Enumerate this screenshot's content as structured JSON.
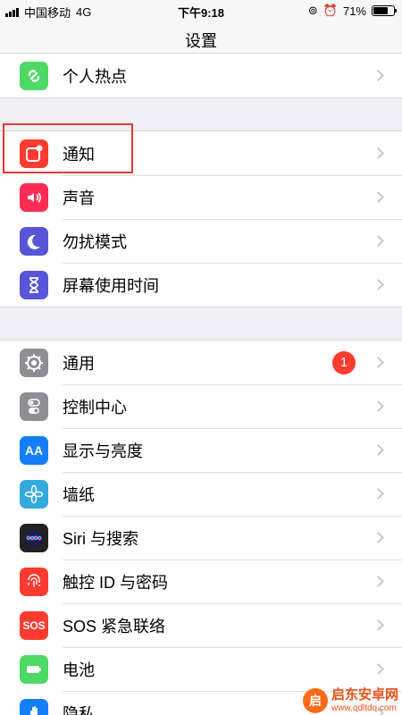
{
  "statusbar": {
    "carrier": "中国移动",
    "network": "4G",
    "time": "下午9:18",
    "battery_percent": "71%",
    "battery_level": 0.71
  },
  "navbar": {
    "title": "设置"
  },
  "sections": [
    {
      "items": [
        {
          "label": "个人热点",
          "icon": "hotspot-icon",
          "color": "#4cd964"
        }
      ]
    },
    {
      "items": [
        {
          "label": "通知",
          "icon": "notifications-icon",
          "color": "#ff3b30"
        },
        {
          "label": "声音",
          "icon": "speaker-icon",
          "color": "#ff2d55"
        },
        {
          "label": "勿扰模式",
          "icon": "moon-icon",
          "color": "#5856d6"
        },
        {
          "label": "屏幕使用时间",
          "icon": "hourglass-icon",
          "color": "#5856d6"
        }
      ]
    },
    {
      "items": [
        {
          "label": "通用",
          "icon": "gear-icon",
          "color": "#8e8e93",
          "badge": "1"
        },
        {
          "label": "控制中心",
          "icon": "toggles-icon",
          "color": "#8e8e93"
        },
        {
          "label": "显示与亮度",
          "icon": "display-icon",
          "color": "#147efb",
          "icon_text": "AA"
        },
        {
          "label": "墙纸",
          "icon": "flower-icon",
          "color": "#34aadc"
        },
        {
          "label": "Siri 与搜索",
          "icon": "siri-icon",
          "color": "#222222"
        },
        {
          "label": "触控 ID 与密码",
          "icon": "fingerprint-icon",
          "color": "#ff3b30"
        },
        {
          "label": "SOS 紧急联络",
          "icon": "sos-icon",
          "color": "#ff3b30",
          "icon_text": "SOS"
        },
        {
          "label": "电池",
          "icon": "battery-icon",
          "color": "#4cd964"
        },
        {
          "label": "隐私",
          "icon": "hand-icon",
          "color": "#147efb"
        }
      ]
    }
  ],
  "watermark": {
    "logo": "启",
    "name": "启东安卓网",
    "url": "www.qdltdq.com"
  }
}
